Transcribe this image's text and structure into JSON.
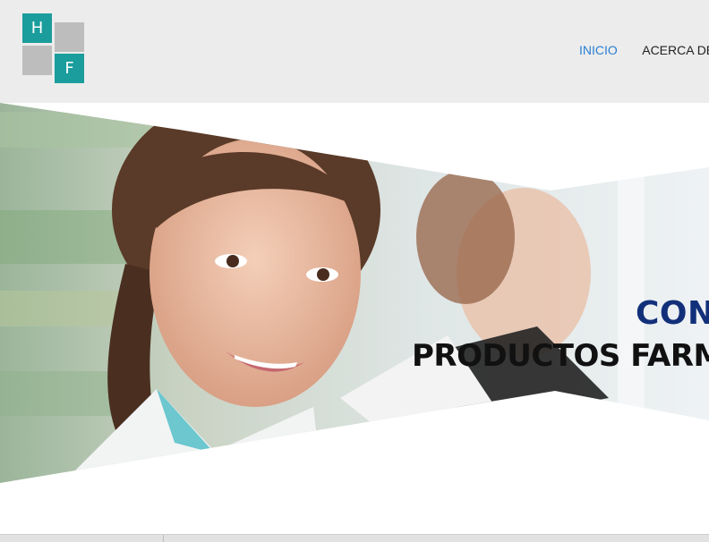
{
  "logo": {
    "letter_top": "H",
    "letter_bottom": "F"
  },
  "nav": {
    "items": [
      {
        "label": "INICIO",
        "active": true
      },
      {
        "label": "ACERCA DE",
        "active": false
      }
    ]
  },
  "hero": {
    "headline_line1": "CON",
    "headline_line2": "PRODUCTOS FARMA"
  },
  "colors": {
    "accent_teal": "#1a9d9c",
    "nav_active": "#2a7fd1",
    "headline_blue": "#12307a"
  }
}
